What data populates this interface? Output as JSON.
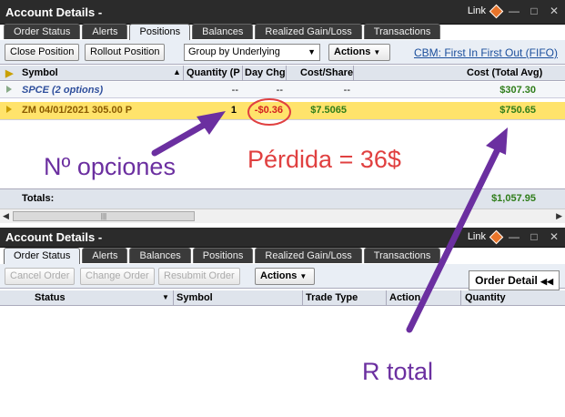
{
  "panel1": {
    "title": "Account Details -",
    "link_label": "Link",
    "tabs": [
      "Order Status",
      "Alerts",
      "Positions",
      "Balances",
      "Realized Gain/Loss",
      "Transactions"
    ],
    "active_tab": "Positions",
    "toolbar": {
      "close_position": "Close Position",
      "rollout_position": "Rollout Position",
      "group_by": "Group by Underlying",
      "actions": "Actions",
      "cost_basis_link": "CBM: First In First Out (FIFO)"
    },
    "columns": [
      "Symbol",
      "Quantity (P",
      "Day Chg",
      "Cost/Share",
      "Cost (Total Avg)"
    ],
    "rows": [
      {
        "symbol": "SPCE (2 options)",
        "quantity": "--",
        "day_chg": "--",
        "cost_share": "--",
        "cost_total": "$307.30"
      },
      {
        "symbol": "ZM 04/01/2021 305.00 P",
        "quantity": "1",
        "day_chg": "-$0.36",
        "cost_share": "$7.5065",
        "cost_total": "$750.65"
      }
    ],
    "totals_label": "Totals:",
    "totals_value": "$1,057.95"
  },
  "panel2": {
    "title": "Account Details -",
    "link_label": "Link",
    "tabs": [
      "Order Status",
      "Alerts",
      "Balances",
      "Positions",
      "Realized Gain/Loss",
      "Transactions"
    ],
    "active_tab": "Order Status",
    "toolbar": {
      "cancel_order": "Cancel Order",
      "change_order": "Change Order",
      "resubmit_order": "Resubmit Order",
      "actions": "Actions",
      "order_detail": "Order Detail"
    },
    "columns": [
      "Status",
      "Symbol",
      "Trade Type",
      "Action",
      "Quantity"
    ]
  },
  "annotations": {
    "options_label": "Nº opciones",
    "loss_label": "Pérdida = 36$",
    "total_label": "R total"
  },
  "colors": {
    "titlebar": "#2b2b2b",
    "highlight_row": "#ffe36b",
    "gain": "#2f7d1a",
    "loss": "#d32020",
    "annotation_purple": "#6b2fa0",
    "annotation_red": "#e04040"
  },
  "icons": [
    "link-diamond-icon",
    "minimize-icon",
    "maximize-icon",
    "close-icon",
    "sort-up-icon",
    "dropdown-arrow-icon",
    "expander-icon"
  ]
}
